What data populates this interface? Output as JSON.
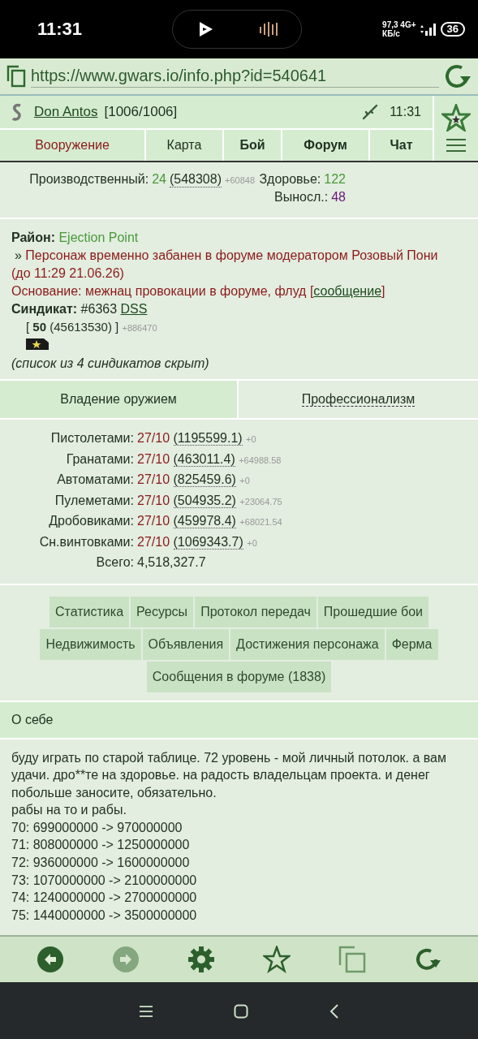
{
  "status_bar": {
    "time": "11:31",
    "net_speed": "97,3",
    "net_type": "4G+",
    "speed_unit": "КБ/с",
    "battery": "36"
  },
  "url_bar": {
    "url": "https://www.gwars.io/info.php?id=540641"
  },
  "header": {
    "player_name": "Don Antos",
    "hp": "[1006/1006]",
    "time": "11:31"
  },
  "nav_tabs": [
    {
      "label": "Вооружение",
      "selected": true,
      "bold": false
    },
    {
      "label": "Карта",
      "selected": false,
      "bold": false
    },
    {
      "label": "Бой",
      "selected": false,
      "bold": true
    },
    {
      "label": "Форум",
      "selected": false,
      "bold": true
    },
    {
      "label": "Чат",
      "selected": false,
      "bold": true
    }
  ],
  "stats": {
    "left": [
      {
        "label": "Производственный:",
        "value": "24",
        "color": "#4a9a3a",
        "exp": "(548308)",
        "gain": "+60848"
      }
    ],
    "right": [
      {
        "label": "Здоровье:",
        "value": "122",
        "color": "#4a9a3a"
      },
      {
        "label": "Выносл.:",
        "value": "48",
        "color": "#6a1a7a"
      }
    ]
  },
  "info": {
    "district_label": "Район:",
    "district": "Ejection Point",
    "ban_mark": "»",
    "ban_text": "Персонаж временно забанен в форуме модератором Розовый Пони (до 11:29 21.06.26)",
    "reason": "Основание: межнац провокации в форуме, флуд [",
    "reason_link": "сообщение",
    "reason_close": "]",
    "syndicate_label": "Синдикат:",
    "syndicate_number": "#6363",
    "syndicate_name": "DSS",
    "syn_open": "[",
    "syn_level": "50",
    "syn_exp": "(45613530)",
    "syn_close": "]",
    "syn_gain": "+886470",
    "hidden_note": "(список из 4 синдикатов скрыт)"
  },
  "section_tabs": [
    {
      "label": "Владение оружием",
      "selected": true
    },
    {
      "label": "Профессионализм",
      "selected": false
    }
  ],
  "skills": [
    {
      "label": "Пистолетами:",
      "grade": "27/10",
      "exp": "(1195599.1)",
      "gain": "+0"
    },
    {
      "label": "Гранатами:",
      "grade": "27/10",
      "exp": "(463011.4)",
      "gain": "+64988.58"
    },
    {
      "label": "Автоматами:",
      "grade": "27/10",
      "exp": "(825459.6)",
      "gain": "+0"
    },
    {
      "label": "Пулеметами:",
      "grade": "27/10",
      "exp": "(504935.2)",
      "gain": "+23064.75"
    },
    {
      "label": "Дробовиками:",
      "grade": "27/10",
      "exp": "(459978.4)",
      "gain": "+68021.54"
    },
    {
      "label": "Сн.винтовками:",
      "grade": "27/10",
      "exp": "(1069343.7)",
      "gain": "+0"
    }
  ],
  "total": {
    "label": "Всего:",
    "value": "4,518,327.7"
  },
  "link_rows": [
    [
      "Статистика",
      "Ресурсы",
      "Протокол передач",
      "Прошедшие бои"
    ],
    [
      "Недвижимость",
      "Объявления",
      "Достижения персонажа",
      "Ферма"
    ],
    [
      "Сообщения в форуме (1838)"
    ]
  ],
  "about": {
    "title": "О себе",
    "lines": [
      "буду играть по старой таблице. 72 уровень - мой личный потолок. а вам удачи. дро**те на здоровье. на радость владельцам проекта. и денег побольше заносите, обязательно.",
      "рабы на то и рабы.",
      "70: 699000000 -> 970000000",
      "71: 808000000 -> 1250000000",
      "72: 936000000 -> 1600000000",
      "73: 1070000000 -> 2100000000",
      "74: 1240000000 -> 2700000000",
      "75: 1440000000 -> 3500000000"
    ]
  },
  "toolbar": [
    {
      "kind": "back",
      "disabled": false
    },
    {
      "kind": "forward",
      "disabled": true
    },
    {
      "kind": "settings",
      "disabled": false
    },
    {
      "kind": "star",
      "disabled": false
    },
    {
      "kind": "tabs",
      "disabled": false
    },
    {
      "kind": "reload",
      "disabled": false
    }
  ]
}
